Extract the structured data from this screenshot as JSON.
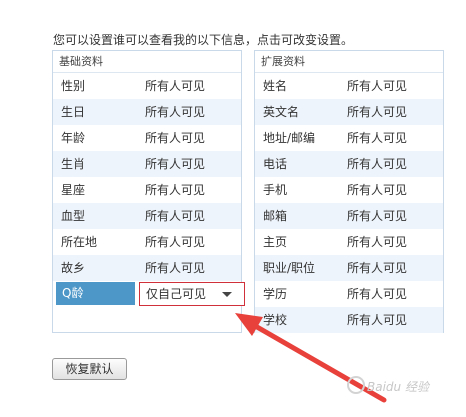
{
  "intro": "您可以设置谁可以查看我的以下信息，点击可改变设置。",
  "basic_panel": {
    "title": "基础资料",
    "rows": [
      {
        "name": "性别",
        "value": "所有人可见"
      },
      {
        "name": "生日",
        "value": "所有人可见"
      },
      {
        "name": "年龄",
        "value": "所有人可见"
      },
      {
        "name": "生肖",
        "value": "所有人可见"
      },
      {
        "name": "星座",
        "value": "所有人可见"
      },
      {
        "name": "血型",
        "value": "所有人可见"
      },
      {
        "name": "所在地",
        "value": "所有人可见"
      },
      {
        "name": "故乡",
        "value": "所有人可见"
      }
    ],
    "selected_row": {
      "name": "Q龄",
      "value": "仅自己可见"
    }
  },
  "ext_panel": {
    "title": "扩展资料",
    "rows": [
      {
        "name": "姓名",
        "value": "所有人可见"
      },
      {
        "name": "英文名",
        "value": "所有人可见"
      },
      {
        "name": "地址/邮编",
        "value": "所有人可见"
      },
      {
        "name": "电话",
        "value": "所有人可见"
      },
      {
        "name": "手机",
        "value": "所有人可见"
      },
      {
        "name": "邮箱",
        "value": "所有人可见"
      },
      {
        "name": "主页",
        "value": "所有人可见"
      },
      {
        "name": "职业/职位",
        "value": "所有人可见"
      },
      {
        "name": "学历",
        "value": "所有人可见"
      },
      {
        "name": "学校",
        "value": "所有人可见"
      }
    ]
  },
  "reset_label": "恢复默认",
  "watermark": "Baidu 经验",
  "colors": {
    "selected_bg": "#4d97c8",
    "select_border": "#d0303a",
    "arrow": "#e8403a",
    "alt_row": "#eef4fb",
    "panel_border": "#c9d9ea"
  },
  "icons": [
    "chevron-down-icon",
    "red-arrow-annotation-icon",
    "baidu-paw-icon"
  ]
}
